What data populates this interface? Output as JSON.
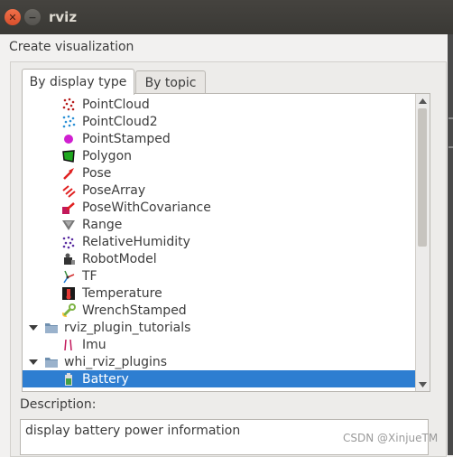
{
  "window": {
    "title": "rviz"
  },
  "dialog": {
    "label": "Create visualization"
  },
  "tabs": [
    {
      "label": "By display type"
    },
    {
      "label": "By topic"
    }
  ],
  "tree": {
    "items": [
      {
        "label": "PointCloud",
        "icon": "pointcloud-icon"
      },
      {
        "label": "PointCloud2",
        "icon": "pointcloud2-icon"
      },
      {
        "label": "PointStamped",
        "icon": "point-stamped-icon"
      },
      {
        "label": "Polygon",
        "icon": "polygon-icon"
      },
      {
        "label": "Pose",
        "icon": "pose-icon"
      },
      {
        "label": "PoseArray",
        "icon": "pose-array-icon"
      },
      {
        "label": "PoseWithCovariance",
        "icon": "pose-covariance-icon"
      },
      {
        "label": "Range",
        "icon": "range-icon"
      },
      {
        "label": "RelativeHumidity",
        "icon": "humidity-icon"
      },
      {
        "label": "RobotModel",
        "icon": "robot-model-icon"
      },
      {
        "label": "TF",
        "icon": "tf-icon"
      },
      {
        "label": "Temperature",
        "icon": "temperature-icon"
      },
      {
        "label": "WrenchStamped",
        "icon": "wrench-icon"
      },
      {
        "label": "rviz_plugin_tutorials",
        "icon": "folder-icon"
      },
      {
        "label": "Imu",
        "icon": "imu-icon"
      },
      {
        "label": "whi_rviz_plugins",
        "icon": "folder-icon"
      },
      {
        "label": "Battery",
        "icon": "battery-icon"
      }
    ],
    "selected": "Battery"
  },
  "description": {
    "label": "Description:",
    "text": "display battery power information"
  },
  "watermark": "CSDN @XinjueTM",
  "colors": {
    "selection": "#2e7ed1",
    "titlebar": "#3c3b37",
    "close": "#e9552d"
  }
}
